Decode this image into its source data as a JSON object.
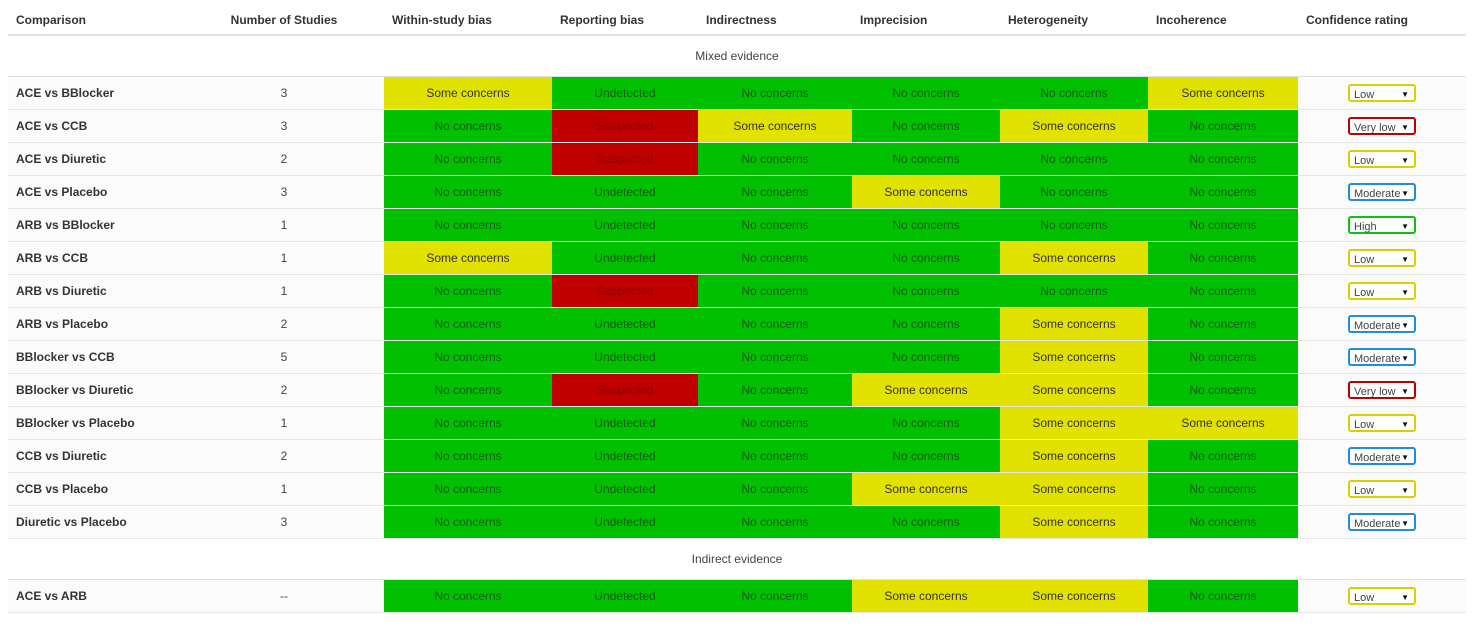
{
  "headers": [
    "Comparison",
    "Number of Studies",
    "Within-study bias",
    "Reporting bias",
    "Indirectness",
    "Imprecision",
    "Heterogeneity",
    "Incoherence",
    "Confidence rating"
  ],
  "sections": [
    {
      "title": "Mixed evidence",
      "rows": [
        {
          "comparison": "ACE vs BBlocker",
          "studies": "3",
          "cells": [
            {
              "t": "Some concerns",
              "c": "yellow"
            },
            {
              "t": "Undetected",
              "c": "green"
            },
            {
              "t": "No concerns",
              "c": "green"
            },
            {
              "t": "No concerns",
              "c": "green"
            },
            {
              "t": "No concerns",
              "c": "green"
            },
            {
              "t": "Some concerns",
              "c": "yellow"
            }
          ],
          "rating": "Low",
          "rating_class": "low"
        },
        {
          "comparison": "ACE vs CCB",
          "studies": "3",
          "cells": [
            {
              "t": "No concerns",
              "c": "green"
            },
            {
              "t": "Suspected",
              "c": "red"
            },
            {
              "t": "Some concerns",
              "c": "yellow"
            },
            {
              "t": "No concerns",
              "c": "green"
            },
            {
              "t": "Some concerns",
              "c": "yellow"
            },
            {
              "t": "No concerns",
              "c": "green"
            }
          ],
          "rating": "Very low",
          "rating_class": "verylow"
        },
        {
          "comparison": "ACE vs Diuretic",
          "studies": "2",
          "cells": [
            {
              "t": "No concerns",
              "c": "green"
            },
            {
              "t": "Suspected",
              "c": "red"
            },
            {
              "t": "No concerns",
              "c": "green"
            },
            {
              "t": "No concerns",
              "c": "green"
            },
            {
              "t": "No concerns",
              "c": "green"
            },
            {
              "t": "No concerns",
              "c": "green"
            }
          ],
          "rating": "Low",
          "rating_class": "low"
        },
        {
          "comparison": "ACE vs Placebo",
          "studies": "3",
          "cells": [
            {
              "t": "No concerns",
              "c": "green"
            },
            {
              "t": "Undetected",
              "c": "green"
            },
            {
              "t": "No concerns",
              "c": "green"
            },
            {
              "t": "Some concerns",
              "c": "yellow"
            },
            {
              "t": "No concerns",
              "c": "green"
            },
            {
              "t": "No concerns",
              "c": "green"
            }
          ],
          "rating": "Moderate",
          "rating_class": "moderate"
        },
        {
          "comparison": "ARB vs BBlocker",
          "studies": "1",
          "cells": [
            {
              "t": "No concerns",
              "c": "green"
            },
            {
              "t": "Undetected",
              "c": "green"
            },
            {
              "t": "No concerns",
              "c": "green"
            },
            {
              "t": "No concerns",
              "c": "green"
            },
            {
              "t": "No concerns",
              "c": "green"
            },
            {
              "t": "No concerns",
              "c": "green"
            }
          ],
          "rating": "High",
          "rating_class": "high"
        },
        {
          "comparison": "ARB vs CCB",
          "studies": "1",
          "cells": [
            {
              "t": "Some concerns",
              "c": "yellow"
            },
            {
              "t": "Undetected",
              "c": "green"
            },
            {
              "t": "No concerns",
              "c": "green"
            },
            {
              "t": "No concerns",
              "c": "green"
            },
            {
              "t": "Some concerns",
              "c": "yellow"
            },
            {
              "t": "No concerns",
              "c": "green"
            }
          ],
          "rating": "Low",
          "rating_class": "low"
        },
        {
          "comparison": "ARB vs Diuretic",
          "studies": "1",
          "cells": [
            {
              "t": "No concerns",
              "c": "green"
            },
            {
              "t": "Suspected",
              "c": "red"
            },
            {
              "t": "No concerns",
              "c": "green"
            },
            {
              "t": "No concerns",
              "c": "green"
            },
            {
              "t": "No concerns",
              "c": "green"
            },
            {
              "t": "No concerns",
              "c": "green"
            }
          ],
          "rating": "Low",
          "rating_class": "low"
        },
        {
          "comparison": "ARB vs Placebo",
          "studies": "2",
          "cells": [
            {
              "t": "No concerns",
              "c": "green"
            },
            {
              "t": "Undetected",
              "c": "green"
            },
            {
              "t": "No concerns",
              "c": "green"
            },
            {
              "t": "No concerns",
              "c": "green"
            },
            {
              "t": "Some concerns",
              "c": "yellow"
            },
            {
              "t": "No concerns",
              "c": "green"
            }
          ],
          "rating": "Moderate",
          "rating_class": "moderate"
        },
        {
          "comparison": "BBlocker vs CCB",
          "studies": "5",
          "cells": [
            {
              "t": "No concerns",
              "c": "green"
            },
            {
              "t": "Undetected",
              "c": "green"
            },
            {
              "t": "No concerns",
              "c": "green"
            },
            {
              "t": "No concerns",
              "c": "green"
            },
            {
              "t": "Some concerns",
              "c": "yellow"
            },
            {
              "t": "No concerns",
              "c": "green"
            }
          ],
          "rating": "Moderate",
          "rating_class": "moderate"
        },
        {
          "comparison": "BBlocker vs Diuretic",
          "studies": "2",
          "cells": [
            {
              "t": "No concerns",
              "c": "green"
            },
            {
              "t": "Suspected",
              "c": "red"
            },
            {
              "t": "No concerns",
              "c": "green"
            },
            {
              "t": "Some concerns",
              "c": "yellow"
            },
            {
              "t": "Some concerns",
              "c": "yellow"
            },
            {
              "t": "No concerns",
              "c": "green"
            }
          ],
          "rating": "Very low",
          "rating_class": "verylow"
        },
        {
          "comparison": "BBlocker vs Placebo",
          "studies": "1",
          "cells": [
            {
              "t": "No concerns",
              "c": "green"
            },
            {
              "t": "Undetected",
              "c": "green"
            },
            {
              "t": "No concerns",
              "c": "green"
            },
            {
              "t": "No concerns",
              "c": "green"
            },
            {
              "t": "Some concerns",
              "c": "yellow"
            },
            {
              "t": "Some concerns",
              "c": "yellow"
            }
          ],
          "rating": "Low",
          "rating_class": "low"
        },
        {
          "comparison": "CCB vs Diuretic",
          "studies": "2",
          "cells": [
            {
              "t": "No concerns",
              "c": "green"
            },
            {
              "t": "Undetected",
              "c": "green"
            },
            {
              "t": "No concerns",
              "c": "green"
            },
            {
              "t": "No concerns",
              "c": "green"
            },
            {
              "t": "Some concerns",
              "c": "yellow"
            },
            {
              "t": "No concerns",
              "c": "green"
            }
          ],
          "rating": "Moderate",
          "rating_class": "moderate"
        },
        {
          "comparison": "CCB vs Placebo",
          "studies": "1",
          "cells": [
            {
              "t": "No concerns",
              "c": "green"
            },
            {
              "t": "Undetected",
              "c": "green"
            },
            {
              "t": "No concerns",
              "c": "green"
            },
            {
              "t": "Some concerns",
              "c": "yellow"
            },
            {
              "t": "Some concerns",
              "c": "yellow"
            },
            {
              "t": "No concerns",
              "c": "green"
            }
          ],
          "rating": "Low",
          "rating_class": "low"
        },
        {
          "comparison": "Diuretic vs Placebo",
          "studies": "3",
          "cells": [
            {
              "t": "No concerns",
              "c": "green"
            },
            {
              "t": "Undetected",
              "c": "green"
            },
            {
              "t": "No concerns",
              "c": "green"
            },
            {
              "t": "No concerns",
              "c": "green"
            },
            {
              "t": "Some concerns",
              "c": "yellow"
            },
            {
              "t": "No concerns",
              "c": "green"
            }
          ],
          "rating": "Moderate",
          "rating_class": "moderate"
        }
      ]
    },
    {
      "title": "Indirect evidence",
      "rows": [
        {
          "comparison": "ACE vs ARB",
          "studies": "--",
          "cells": [
            {
              "t": "No concerns",
              "c": "green"
            },
            {
              "t": "Undetected",
              "c": "green"
            },
            {
              "t": "No concerns",
              "c": "green"
            },
            {
              "t": "Some concerns",
              "c": "yellow"
            },
            {
              "t": "Some concerns",
              "c": "yellow"
            },
            {
              "t": "No concerns",
              "c": "green"
            }
          ],
          "rating": "Low",
          "rating_class": "low"
        }
      ]
    }
  ],
  "colors": {
    "green": "#00c000",
    "yellow": "#e2e200",
    "red": "#c00000"
  },
  "icons": {
    "dropdown": "triangle-down-icon"
  }
}
